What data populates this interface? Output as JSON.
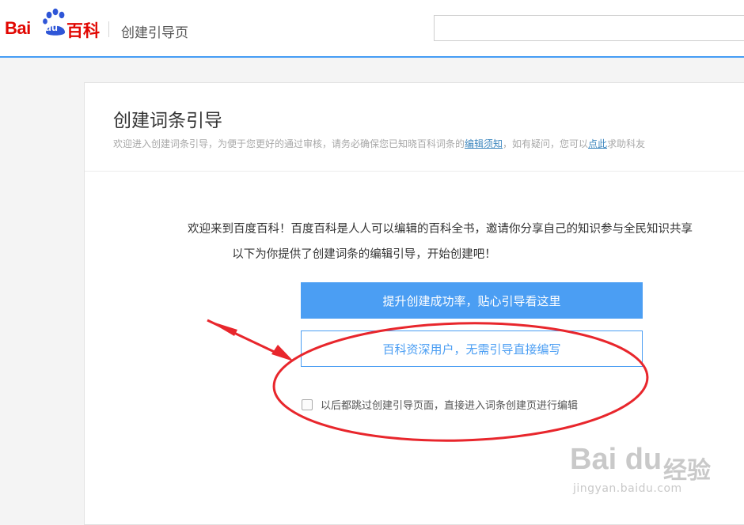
{
  "header": {
    "logo_text": "Bai",
    "logo_du": "du",
    "logo_baike": "百科",
    "page_name": "创建引导页",
    "search_value": ""
  },
  "card": {
    "title": "创建词条引导",
    "subtitle_before": "欢迎进入创建词条引导，为便于您更好的通过审核，请务必确保您已知晓百科词条的",
    "subtitle_link1": "编辑须知",
    "subtitle_middle": "，如有疑问，您可以",
    "subtitle_link2": "点此",
    "subtitle_after": "求助科友"
  },
  "main": {
    "welcome_line1": "欢迎来到百度百科！百度百科是人人可以编辑的百科全书，邀请你分享自己的知识参与全民知识共享",
    "welcome_line2": "以下为你提供了创建词条的编辑引导，开始创建吧！",
    "primary_button": "提升创建成功率，贴心引导看这里",
    "secondary_button": "百科资深用户，无需引导直接编写",
    "skip_checkbox_label": "以后都跳过创建引导页面，直接进入词条创建页进行编辑",
    "skip_checked": false
  },
  "watermark": {
    "brand": "Bai du",
    "label": "经验",
    "url": "jingyan.baidu.com"
  },
  "colors": {
    "accent": "#4b9ef3",
    "logo_red": "#e10601",
    "annotation_red": "#e8262c"
  },
  "icons": [
    "baidu-paw-icon",
    "checkbox-icon"
  ]
}
